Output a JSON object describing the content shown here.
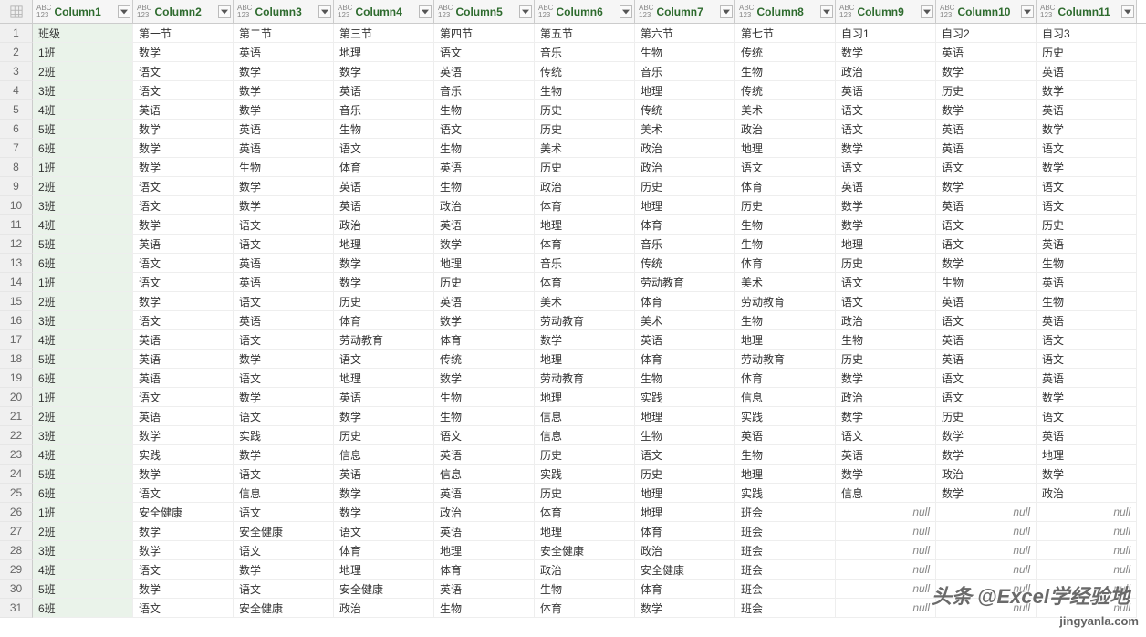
{
  "null_text": "null",
  "columns": [
    {
      "label": "Column1"
    },
    {
      "label": "Column2"
    },
    {
      "label": "Column3"
    },
    {
      "label": "Column4"
    },
    {
      "label": "Column5"
    },
    {
      "label": "Column6"
    },
    {
      "label": "Column7"
    },
    {
      "label": "Column8"
    },
    {
      "label": "Column9"
    },
    {
      "label": "Column10"
    },
    {
      "label": "Column11"
    }
  ],
  "rows": [
    {
      "n": 1,
      "c": [
        "班级",
        "第一节",
        "第二节",
        "第三节",
        "第四节",
        "第五节",
        "第六节",
        "第七节",
        "自习1",
        "自习2",
        "自习3"
      ]
    },
    {
      "n": 2,
      "c": [
        "1班",
        "数学",
        "英语",
        "地理",
        "语文",
        "音乐",
        "生物",
        "传统",
        "数学",
        "英语",
        "历史"
      ]
    },
    {
      "n": 3,
      "c": [
        "2班",
        "语文",
        "数学",
        "数学",
        "英语",
        "传统",
        "音乐",
        "生物",
        "政治",
        "数学",
        "英语"
      ]
    },
    {
      "n": 4,
      "c": [
        "3班",
        "语文",
        "数学",
        "英语",
        "音乐",
        "生物",
        "地理",
        "传统",
        "英语",
        "历史",
        "数学"
      ]
    },
    {
      "n": 5,
      "c": [
        "4班",
        "英语",
        "数学",
        "音乐",
        "生物",
        "历史",
        "传统",
        "美术",
        "语文",
        "数学",
        "英语"
      ]
    },
    {
      "n": 6,
      "c": [
        "5班",
        "数学",
        "英语",
        "生物",
        "语文",
        "历史",
        "美术",
        "政治",
        "语文",
        "英语",
        "数学"
      ]
    },
    {
      "n": 7,
      "c": [
        "6班",
        "数学",
        "英语",
        "语文",
        "生物",
        "美术",
        "政治",
        "地理",
        "数学",
        "英语",
        "语文"
      ]
    },
    {
      "n": 8,
      "c": [
        "1班",
        "数学",
        "生物",
        "体育",
        "英语",
        "历史",
        "政治",
        "语文",
        "语文",
        "语文",
        "数学"
      ]
    },
    {
      "n": 9,
      "c": [
        "2班",
        "语文",
        "数学",
        "英语",
        "生物",
        "政治",
        "历史",
        "体育",
        "英语",
        "数学",
        "语文"
      ]
    },
    {
      "n": 10,
      "c": [
        "3班",
        "语文",
        "数学",
        "英语",
        "政治",
        "体育",
        "地理",
        "历史",
        "数学",
        "英语",
        "语文"
      ]
    },
    {
      "n": 11,
      "c": [
        "4班",
        "数学",
        "语文",
        "政治",
        "英语",
        "地理",
        "体育",
        "生物",
        "数学",
        "语文",
        "历史"
      ]
    },
    {
      "n": 12,
      "c": [
        "5班",
        "英语",
        "语文",
        "地理",
        "数学",
        "体育",
        "音乐",
        "生物",
        "地理",
        "语文",
        "英语"
      ]
    },
    {
      "n": 13,
      "c": [
        "6班",
        "语文",
        "英语",
        "数学",
        "地理",
        "音乐",
        "传统",
        "体育",
        "历史",
        "数学",
        "生物"
      ]
    },
    {
      "n": 14,
      "c": [
        "1班",
        "语文",
        "英语",
        "数学",
        "历史",
        "体育",
        "劳动教育",
        "美术",
        "语文",
        "生物",
        "英语"
      ]
    },
    {
      "n": 15,
      "c": [
        "2班",
        "数学",
        "语文",
        "历史",
        "英语",
        "美术",
        "体育",
        "劳动教育",
        "语文",
        "英语",
        "生物"
      ]
    },
    {
      "n": 16,
      "c": [
        "3班",
        "语文",
        "英语",
        "体育",
        "数学",
        "劳动教育",
        "美术",
        "生物",
        "政治",
        "语文",
        "英语"
      ]
    },
    {
      "n": 17,
      "c": [
        "4班",
        "英语",
        "语文",
        "劳动教育",
        "体育",
        "数学",
        "英语",
        "地理",
        "生物",
        "英语",
        "语文"
      ]
    },
    {
      "n": 18,
      "c": [
        "5班",
        "英语",
        "数学",
        "语文",
        "传统",
        "地理",
        "体育",
        "劳动教育",
        "历史",
        "英语",
        "语文"
      ]
    },
    {
      "n": 19,
      "c": [
        "6班",
        "英语",
        "语文",
        "地理",
        "数学",
        "劳动教育",
        "生物",
        "体育",
        "数学",
        "语文",
        "英语"
      ]
    },
    {
      "n": 20,
      "c": [
        "1班",
        "语文",
        "数学",
        "英语",
        "生物",
        "地理",
        "实践",
        "信息",
        "政治",
        "语文",
        "数学"
      ]
    },
    {
      "n": 21,
      "c": [
        "2班",
        "英语",
        "语文",
        "数学",
        "生物",
        "信息",
        "地理",
        "实践",
        "数学",
        "历史",
        "语文"
      ]
    },
    {
      "n": 22,
      "c": [
        "3班",
        "数学",
        "实践",
        "历史",
        "语文",
        "信息",
        "生物",
        "英语",
        "语文",
        "数学",
        "英语"
      ]
    },
    {
      "n": 23,
      "c": [
        "4班",
        "实践",
        "数学",
        "信息",
        "英语",
        "历史",
        "语文",
        "生物",
        "英语",
        "数学",
        "地理"
      ]
    },
    {
      "n": 24,
      "c": [
        "5班",
        "数学",
        "语文",
        "英语",
        "信息",
        "实践",
        "历史",
        "地理",
        "数学",
        "政治",
        "数学"
      ]
    },
    {
      "n": 25,
      "c": [
        "6班",
        "语文",
        "信息",
        "数学",
        "英语",
        "历史",
        "地理",
        "实践",
        "信息",
        "数学",
        "政治"
      ]
    },
    {
      "n": 26,
      "c": [
        "1班",
        "安全健康",
        "语文",
        "数学",
        "政治",
        "体育",
        "地理",
        "班会",
        null,
        null,
        null
      ]
    },
    {
      "n": 27,
      "c": [
        "2班",
        "数学",
        "安全健康",
        "语文",
        "英语",
        "地理",
        "体育",
        "班会",
        null,
        null,
        null
      ]
    },
    {
      "n": 28,
      "c": [
        "3班",
        "数学",
        "语文",
        "体育",
        "地理",
        "安全健康",
        "政治",
        "班会",
        null,
        null,
        null
      ]
    },
    {
      "n": 29,
      "c": [
        "4班",
        "语文",
        "数学",
        "地理",
        "体育",
        "政治",
        "安全健康",
        "班会",
        null,
        null,
        null
      ]
    },
    {
      "n": 30,
      "c": [
        "5班",
        "数学",
        "语文",
        "安全健康",
        "英语",
        "生物",
        "体育",
        "班会",
        null,
        null,
        null
      ]
    },
    {
      "n": 31,
      "c": [
        "6班",
        "语文",
        "安全健康",
        "政治",
        "生物",
        "体育",
        "数学",
        "班会",
        null,
        null,
        null
      ]
    }
  ],
  "watermark1": "头条 @Excel学经验地",
  "watermark2": "jingyanla.com"
}
